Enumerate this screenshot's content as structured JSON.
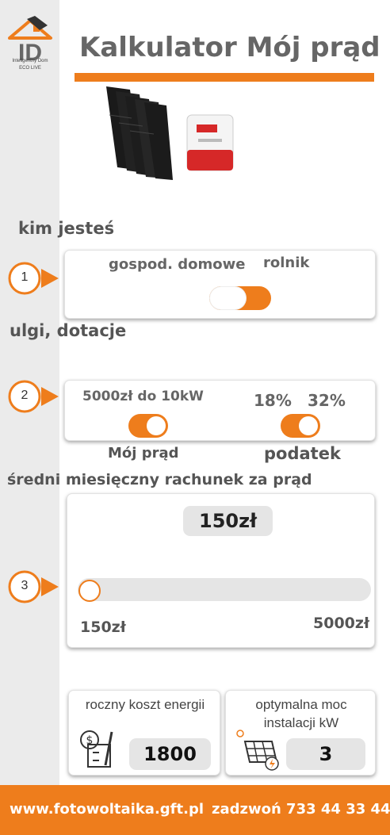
{
  "header": {
    "logo_text": "ID",
    "logo_tagline": "Inteligentny Dom\nECO LIVE",
    "title": "Kalkulator Mój prąd"
  },
  "section1": {
    "heading": "kim jesteś",
    "step": "1",
    "option_left": "gospod. domowe",
    "option_right": "rolnik",
    "toggle_state": "rolnik"
  },
  "section2": {
    "heading": "ulgi, dotacje",
    "step": "2",
    "grant_label": "5000zł do 10kW",
    "grant_toggle_label": "Mój prąd",
    "tax_low": "18%",
    "tax_high": "32%",
    "tax_toggle_label": "podatek"
  },
  "section3": {
    "heading": "średni miesięczny rachunek za prąd",
    "step": "3",
    "current_value": "150zł",
    "min_label": "150zł",
    "max_label": "5000zł",
    "slider_fraction": 0
  },
  "results": {
    "annual_cost_title": "roczny koszt energii",
    "annual_cost_value": "1800",
    "optimal_power_title": "optymalna moc instalacji kW",
    "optimal_power_value": "3"
  },
  "footer": {
    "website": "www.fotowoltaika.gft.pl",
    "phone": "zadzwoń 733 44 33 44"
  },
  "colors": {
    "accent": "#ee7d1c",
    "sidebar": "#ebebeb",
    "pill": "#e5e5e5"
  },
  "icons": [
    "logo-house-icon",
    "solar-panels-image",
    "inverter-image",
    "step-arrow-icon",
    "calculator-money-icon",
    "solar-panel-bolt-icon"
  ]
}
